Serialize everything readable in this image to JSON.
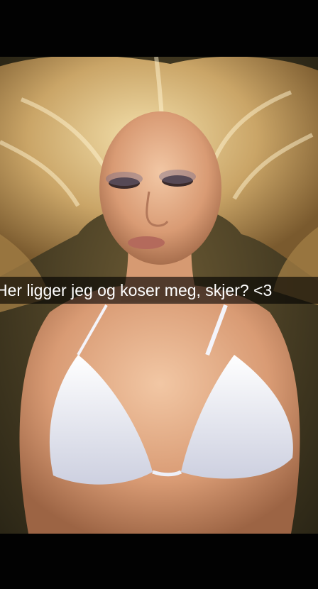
{
  "snap": {
    "caption": "Her ligger jeg og koser meg, skjer? <3"
  },
  "colors": {
    "background": "#020202",
    "caption_bg": "rgba(0,0,0,0.62)",
    "caption_text": "#ffffff"
  }
}
